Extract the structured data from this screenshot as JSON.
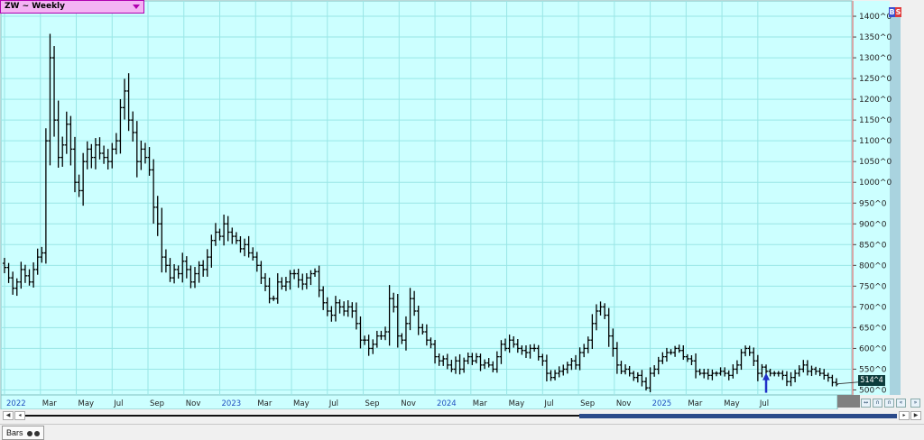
{
  "symbol_label": "ZW ~ Weekly",
  "last_price_tag": "514^4",
  "status_tab_label": "Bars",
  "buttons": {
    "buy": "B",
    "sell": "S"
  },
  "colors": {
    "plot_bg": "#ccffff",
    "grid": "#99e6e6",
    "bars": "#000000",
    "cursor_line": "#e05050",
    "date_blue": "#2050c0",
    "signal_arrow": "#2030c8"
  },
  "icons": [
    "dropdown-arrow-icon",
    "scroll-left-icon",
    "scroll-right-icon",
    "scroll-first-icon",
    "scroll-last-icon",
    "bars-style-icon",
    "zoom-icon"
  ],
  "chart_data": {
    "type": "ohlc",
    "x_labels": [
      "2022",
      "Mar",
      "May",
      "Jul",
      "Sep",
      "Nov",
      "2023",
      "Mar",
      "May",
      "Jul",
      "Sep",
      "Nov",
      "2024",
      "Mar",
      "May",
      "Jul",
      "Sep",
      "Nov",
      "2025",
      "Mar",
      "May",
      "Jul"
    ],
    "year_labels": [
      "2022",
      "2023",
      "2024",
      "2025"
    ],
    "y_tick_labels": [
      "500^0",
      "550^0",
      "600^0",
      "650^0",
      "700^0",
      "750^0",
      "800^0",
      "850^0",
      "900^0",
      "950^0",
      "1000^0",
      "1050^0",
      "1100^0",
      "1150^0",
      "1200^0",
      "1250^0",
      "1300^0",
      "1350^0",
      "1400^0"
    ],
    "y_ticks": [
      500,
      550,
      600,
      650,
      700,
      750,
      800,
      850,
      900,
      950,
      1000,
      1050,
      1100,
      1150,
      1200,
      1250,
      1300,
      1350,
      1400
    ],
    "ylim": [
      488,
      1437
    ],
    "last_price": 514.5,
    "signal": {
      "kind": "buy-arrow",
      "week_index": 184,
      "price": 528
    },
    "close": [
      795,
      770,
      745,
      760,
      790,
      775,
      760,
      790,
      820,
      830,
      1100,
      1300,
      1150,
      1060,
      1090,
      1140,
      1080,
      1000,
      980,
      1050,
      1080,
      1060,
      1090,
      1070,
      1060,
      1050,
      1080,
      1100,
      1180,
      1220,
      1150,
      1120,
      1050,
      1080,
      1060,
      1030,
      940,
      900,
      820,
      800,
      770,
      790,
      780,
      810,
      790,
      760,
      780,
      800,
      790,
      820,
      860,
      880,
      870,
      900,
      880,
      870,
      860,
      840,
      850,
      830,
      820,
      800,
      770,
      750,
      720,
      720,
      760,
      750,
      760,
      780,
      780,
      765,
      755,
      770,
      780,
      785,
      740,
      710,
      690,
      680,
      710,
      700,
      690,
      700,
      690,
      660,
      620,
      620,
      600,
      610,
      630,
      630,
      640,
      720,
      700,
      630,
      620,
      660,
      720,
      690,
      650,
      640,
      620,
      610,
      580,
      570,
      575,
      560,
      550,
      570,
      550,
      570,
      580,
      570,
      580,
      560,
      565,
      560,
      550,
      580,
      610,
      600,
      620,
      610,
      600,
      595,
      590,
      600,
      600,
      580,
      570,
      540,
      530,
      540,
      545,
      550,
      560,
      570,
      560,
      590,
      600,
      620,
      660,
      690,
      700,
      680,
      630,
      600,
      560,
      545,
      550,
      540,
      530,
      535,
      520,
      505,
      540,
      550,
      570,
      580,
      590,
      590,
      600,
      595,
      580,
      575,
      570,
      545,
      540,
      540,
      535,
      540,
      540,
      545,
      540,
      535,
      550,
      560,
      590,
      600,
      590,
      570,
      540,
      555,
      545,
      540,
      540,
      540,
      535,
      520,
      530,
      540,
      550,
      560,
      545,
      550,
      545,
      540,
      535,
      530,
      518,
      514
    ]
  }
}
